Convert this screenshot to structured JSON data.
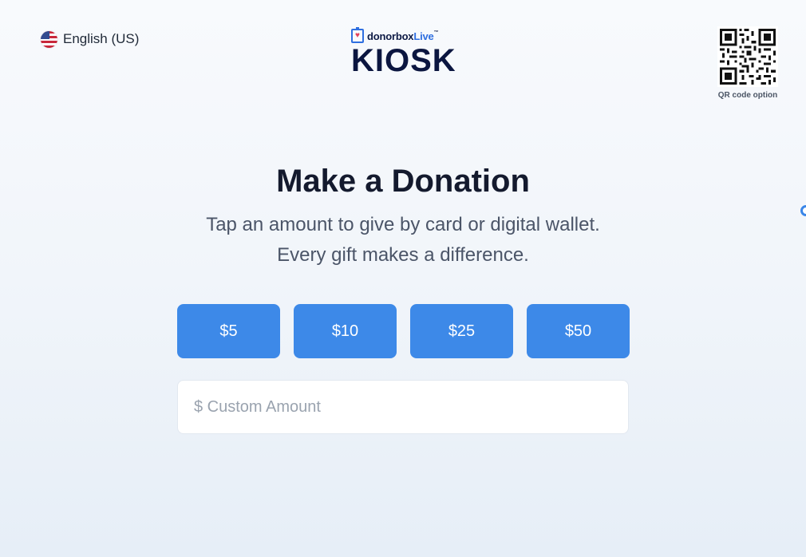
{
  "language": {
    "label": "English (US)",
    "icon": "us-flag-icon"
  },
  "brand": {
    "name": "donorbox",
    "live": "Live",
    "tm": "™",
    "product": "KIOSK"
  },
  "qr": {
    "label": "QR code option",
    "icon": "qr-code-icon"
  },
  "main": {
    "title": "Make a Donation",
    "subtitle_line1": "Tap an amount to give by card or digital wallet.",
    "subtitle_line2": "Every gift makes a difference."
  },
  "amounts": [
    "$5",
    "$10",
    "$25",
    "$50"
  ],
  "custom_amount": {
    "placeholder": "$ Custom Amount",
    "value": ""
  },
  "colors": {
    "button": "#3d89e8",
    "title": "#141a2e",
    "brand_dark": "#0b1640",
    "brand_blue": "#2f6fe0"
  }
}
